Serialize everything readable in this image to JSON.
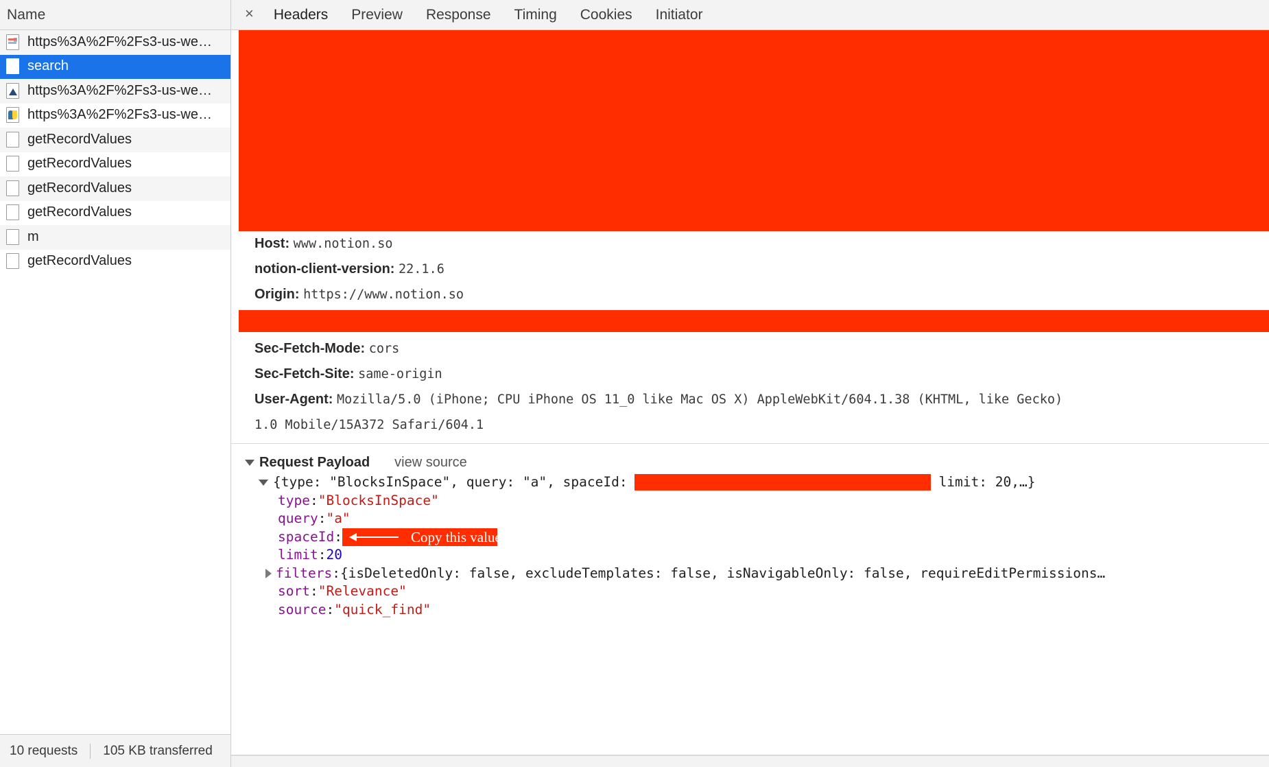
{
  "sidebar": {
    "header": "Name",
    "requests": [
      {
        "name": "https%3A%2F%2Fs3-us-we…",
        "icon": "document-icon"
      },
      {
        "name": "search",
        "icon": "blank-document-icon",
        "selected": true
      },
      {
        "name": "https%3A%2F%2Fs3-us-we…",
        "icon": "image-icon"
      },
      {
        "name": "https%3A%2F%2Fs3-us-we…",
        "icon": "python-icon"
      },
      {
        "name": "getRecordValues",
        "icon": "blank-document-icon"
      },
      {
        "name": "getRecordValues",
        "icon": "blank-document-icon"
      },
      {
        "name": "getRecordValues",
        "icon": "blank-document-icon"
      },
      {
        "name": "getRecordValues",
        "icon": "blank-document-icon"
      },
      {
        "name": "m",
        "icon": "blank-document-icon"
      },
      {
        "name": "getRecordValues",
        "icon": "blank-document-icon"
      }
    ],
    "footer": {
      "requests_count": "10 requests",
      "transferred": "105 KB transferred"
    }
  },
  "detail": {
    "close_label": "×",
    "tabs": [
      {
        "label": "Headers",
        "active": true
      },
      {
        "label": "Preview",
        "active": false
      },
      {
        "label": "Response",
        "active": false
      },
      {
        "label": "Timing",
        "active": false
      },
      {
        "label": "Cookies",
        "active": false
      },
      {
        "label": "Initiator",
        "active": false
      }
    ],
    "headers": [
      {
        "key": "Host:",
        "value": "www.notion.so"
      },
      {
        "key": "notion-client-version:",
        "value": "22.1.6"
      },
      {
        "key": "Origin:",
        "value": "https://www.notion.so"
      },
      {
        "key": "Sec-Fetch-Mode:",
        "value": "cors"
      },
      {
        "key": "Sec-Fetch-Site:",
        "value": "same-origin"
      }
    ],
    "user_agent": {
      "key": "User-Agent:",
      "line1": "Mozilla/5.0 (iPhone; CPU iPhone OS 11_0 like Mac OS X) AppleWebKit/604.1.38 (KHTML, like Gecko)",
      "line2": "1.0 Mobile/15A372 Safari/604.1"
    },
    "payload": {
      "title": "Request Payload",
      "view_source": "view source",
      "summary_prefix": "{type: \"BlocksInSpace\", query: \"a\", spaceId:",
      "summary_suffix": "limit: 20,…}",
      "rows": [
        {
          "key": "type",
          "sep": ": ",
          "value": "\"BlocksInSpace\"",
          "value_class": "s"
        },
        {
          "key": "query",
          "sep": ": ",
          "value": "\"a\"",
          "value_class": "s"
        },
        {
          "key": "spaceId",
          "sep": ": ",
          "value": "",
          "value_class": "redacted",
          "annotation": "Copy this value"
        },
        {
          "key": "limit",
          "sep": ": ",
          "value": "20",
          "value_class": "n"
        },
        {
          "key": "filters",
          "sep": ": ",
          "value": "{isDeletedOnly: false, excludeTemplates: false, isNavigableOnly: false, requireEditPermissions…",
          "value_class": "pl",
          "expandable": true
        },
        {
          "key": "sort",
          "sep": ": ",
          "value": "\"Relevance\"",
          "value_class": "s"
        },
        {
          "key": "source",
          "sep": ": ",
          "value": "\"quick_find\"",
          "value_class": "s"
        }
      ]
    }
  },
  "colors": {
    "redaction": "#ff2d00",
    "selection": "#1a73e8",
    "json_key": "#881391",
    "json_string": "#c41a16",
    "json_number": "#1c00cf"
  }
}
